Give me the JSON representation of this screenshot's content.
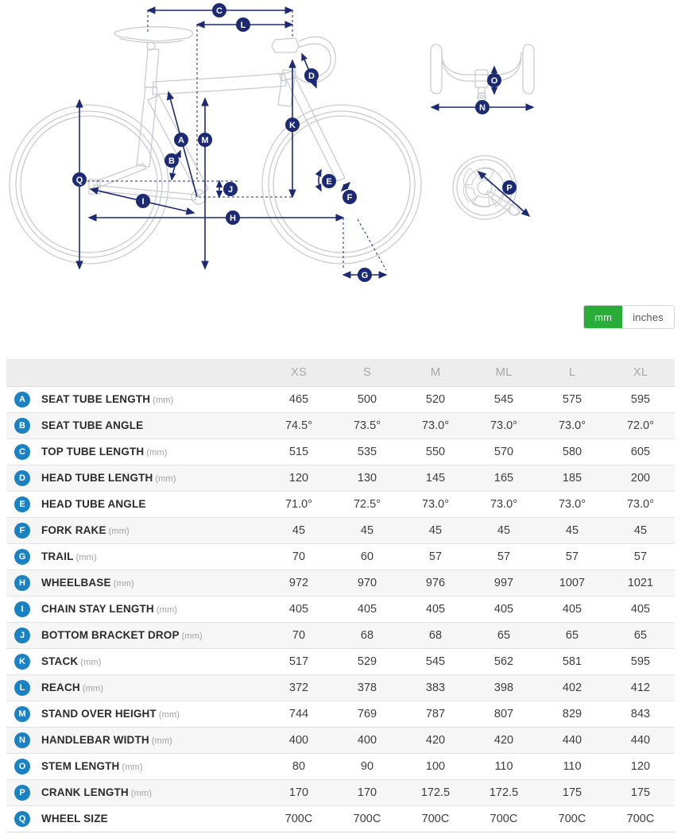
{
  "units_toggle": {
    "options": [
      {
        "label": "mm",
        "active": true
      },
      {
        "label": "inches",
        "active": false
      }
    ],
    "active_color": "#2aac38"
  },
  "diagram": {
    "title": "Bike geometry measurement diagram",
    "views": [
      {
        "name": "side-view-bicycle",
        "markers": [
          "C",
          "L",
          "D",
          "A",
          "B",
          "M",
          "K",
          "J",
          "I",
          "E",
          "F",
          "H",
          "G",
          "Q"
        ]
      },
      {
        "name": "handlebar-top-view",
        "markers": [
          "O",
          "N"
        ]
      },
      {
        "name": "crankset-view",
        "markers": [
          "P"
        ]
      }
    ],
    "marker_color": "#1b2a72",
    "outline_color": "#c9cbd0"
  },
  "table": {
    "badge_color": "#1a82c3",
    "header": {
      "badge_col": "",
      "label_col": "",
      "sizes": [
        "XS",
        "S",
        "M",
        "ML",
        "L",
        "XL"
      ]
    },
    "rows": [
      {
        "badge": "A",
        "label": "SEAT TUBE LENGTH",
        "unit": "(mm)",
        "values": [
          "465",
          "500",
          "520",
          "545",
          "575",
          "595"
        ]
      },
      {
        "badge": "B",
        "label": "SEAT TUBE ANGLE",
        "unit": "",
        "values": [
          "74.5°",
          "73.5°",
          "73.0°",
          "73.0°",
          "73.0°",
          "72.0°"
        ]
      },
      {
        "badge": "C",
        "label": "TOP TUBE LENGTH",
        "unit": "(mm)",
        "values": [
          "515",
          "535",
          "550",
          "570",
          "580",
          "605"
        ]
      },
      {
        "badge": "D",
        "label": "HEAD TUBE LENGTH",
        "unit": "(mm)",
        "values": [
          "120",
          "130",
          "145",
          "165",
          "185",
          "200"
        ]
      },
      {
        "badge": "E",
        "label": "HEAD TUBE ANGLE",
        "unit": "",
        "values": [
          "71.0°",
          "72.5°",
          "73.0°",
          "73.0°",
          "73.0°",
          "73.0°"
        ]
      },
      {
        "badge": "F",
        "label": "FORK RAKE",
        "unit": "(mm)",
        "values": [
          "45",
          "45",
          "45",
          "45",
          "45",
          "45"
        ]
      },
      {
        "badge": "G",
        "label": "TRAIL",
        "unit": "(mm)",
        "values": [
          "70",
          "60",
          "57",
          "57",
          "57",
          "57"
        ]
      },
      {
        "badge": "H",
        "label": "WHEELBASE",
        "unit": "(mm)",
        "values": [
          "972",
          "970",
          "976",
          "997",
          "1007",
          "1021"
        ]
      },
      {
        "badge": "I",
        "label": "CHAIN STAY LENGTH",
        "unit": "(mm)",
        "values": [
          "405",
          "405",
          "405",
          "405",
          "405",
          "405"
        ]
      },
      {
        "badge": "J",
        "label": "BOTTOM BRACKET DROP",
        "unit": "(mm)",
        "values": [
          "70",
          "68",
          "68",
          "65",
          "65",
          "65"
        ]
      },
      {
        "badge": "K",
        "label": "STACK",
        "unit": "(mm)",
        "values": [
          "517",
          "529",
          "545",
          "562",
          "581",
          "595"
        ]
      },
      {
        "badge": "L",
        "label": "REACH",
        "unit": "(mm)",
        "values": [
          "372",
          "378",
          "383",
          "398",
          "402",
          "412"
        ]
      },
      {
        "badge": "M",
        "label": "STAND OVER HEIGHT",
        "unit": "(mm)",
        "values": [
          "744",
          "769",
          "787",
          "807",
          "829",
          "843"
        ]
      },
      {
        "badge": "N",
        "label": "HANDLEBAR WIDTH",
        "unit": "(mm)",
        "values": [
          "400",
          "400",
          "420",
          "420",
          "440",
          "440"
        ]
      },
      {
        "badge": "O",
        "label": "STEM LENGTH",
        "unit": "(mm)",
        "values": [
          "80",
          "90",
          "100",
          "110",
          "110",
          "120"
        ]
      },
      {
        "badge": "P",
        "label": "CRANK LENGTH",
        "unit": "(mm)",
        "values": [
          "170",
          "170",
          "172.5",
          "172.5",
          "175",
          "175"
        ]
      },
      {
        "badge": "Q",
        "label": "WHEEL SIZE",
        "unit": "",
        "values": [
          "700C",
          "700C",
          "700C",
          "700C",
          "700C",
          "700C"
        ]
      }
    ]
  }
}
